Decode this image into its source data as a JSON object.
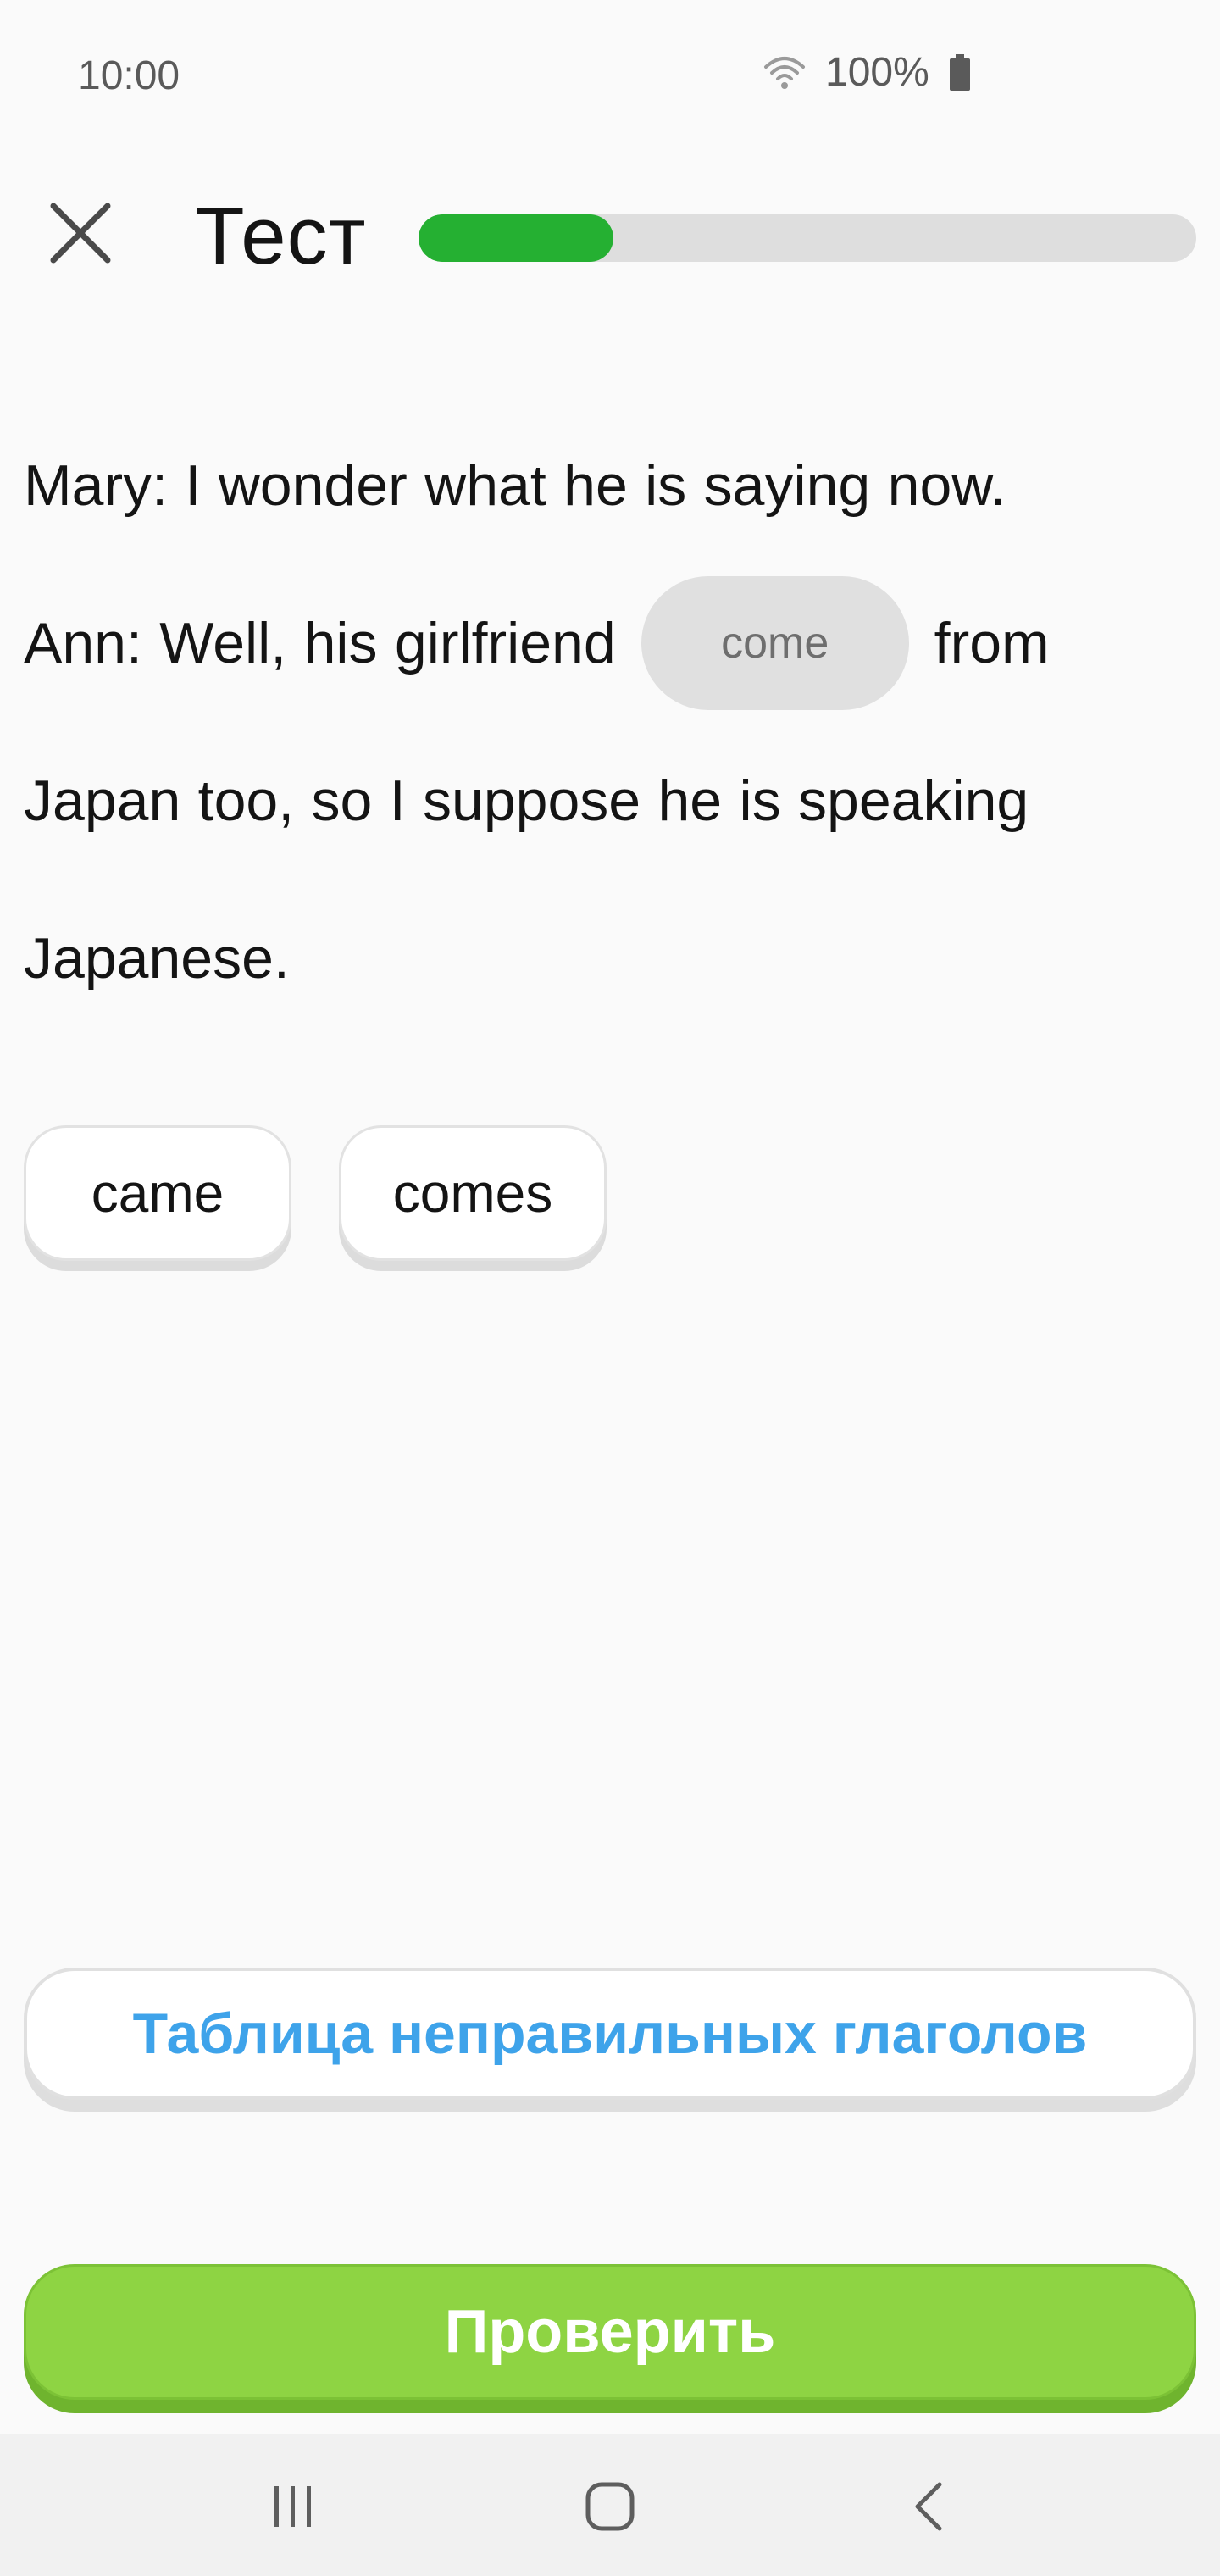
{
  "status_bar": {
    "time": "10:00",
    "battery": "100%"
  },
  "header": {
    "title": "Тест",
    "progress": 0.25,
    "progress_color": "#25b032"
  },
  "question": {
    "line1": [
      "Mary:",
      "I",
      "wonder",
      "what",
      "he",
      "is",
      "saying",
      "now."
    ],
    "line2_before": [
      "Ann:",
      "Well,",
      "his",
      "girlfriend"
    ],
    "blank_answer": "come",
    "line2_after": [
      "from"
    ],
    "line3": [
      "Japan",
      "too,",
      "so",
      "I",
      "suppose",
      "he",
      "is",
      "speaking"
    ],
    "line4": [
      "Japanese."
    ]
  },
  "options": [
    "came",
    "comes"
  ],
  "buttons": {
    "verbs_table": "Таблица неправильных глаголов",
    "check": "Проверить"
  },
  "colors": {
    "accent_blue": "#3ea3ea",
    "check_green": "#8ed443"
  },
  "icons": [
    "close-icon",
    "wifi-icon",
    "battery-icon",
    "recent-apps-icon",
    "home-icon",
    "back-icon"
  ]
}
